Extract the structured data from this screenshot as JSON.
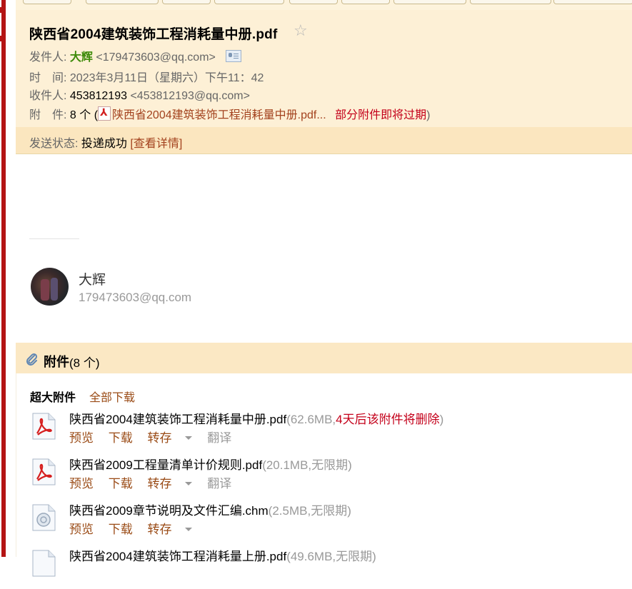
{
  "email": {
    "subject": "陕西省2004建筑装饰工程消耗量中册.pdf",
    "from_label": "发件人:",
    "from_name": "大辉",
    "from_email": "<179473603@qq.com>",
    "time_label": "时　间:",
    "time_value": "2023年3月11日（星期六）下午11：42",
    "to_label": "收件人:",
    "to_value": "453812193",
    "to_email": "<453812193@qq.com>",
    "attach_label": "附　件:",
    "attach_count": "8 个 (",
    "attach_first": "陕西省2004建筑装饰工程消耗量中册.pdf...",
    "attach_warn": "部分附件即将过期",
    "attach_close": ")",
    "status_label": "发送状态:",
    "status_value": "投递成功",
    "status_link": "[查看详情]"
  },
  "signature": {
    "name": "大辉",
    "email": "179473603@qq.com"
  },
  "attachments": {
    "title": "附件",
    "count": "(8 个)",
    "section_label": "超大附件",
    "download_all": "全部下载",
    "files": [
      {
        "name": "陕西省2004建筑装饰工程消耗量中册.pdf",
        "meta_open": "(62.6MB,",
        "warn": "4天后该附件将删除",
        "meta_close": ")",
        "icon": "pdf-icon",
        "actions": [
          "预览",
          "下载",
          "转存"
        ],
        "extra": "翻译"
      },
      {
        "name": "陕西省2009工程量清单计价规则.pdf",
        "meta_open": "(20.1MB,无限期)",
        "warn": "",
        "meta_close": "",
        "icon": "pdf-icon",
        "actions": [
          "预览",
          "下载",
          "转存"
        ],
        "extra": "翻译"
      },
      {
        "name": "陕西省2009章节说明及文件汇编.chm",
        "meta_open": "(2.5MB,无限期)",
        "warn": "",
        "meta_close": "",
        "icon": "chm-icon",
        "actions": [
          "预览",
          "下载",
          "转存"
        ],
        "extra": ""
      },
      {
        "name": "陕西省2004建筑装饰工程消耗量上册.pdf",
        "meta_open": "(49.6MB,无限期)",
        "warn": "",
        "meta_close": "",
        "icon": "pdf-icon",
        "actions": [],
        "extra": ""
      }
    ]
  },
  "colors": {
    "header_bg": "#fdf0d6",
    "status_bg": "#fbe6bf",
    "link": "#9a4b16",
    "warn": "#c4001a",
    "sender_green": "#3c8a08"
  }
}
